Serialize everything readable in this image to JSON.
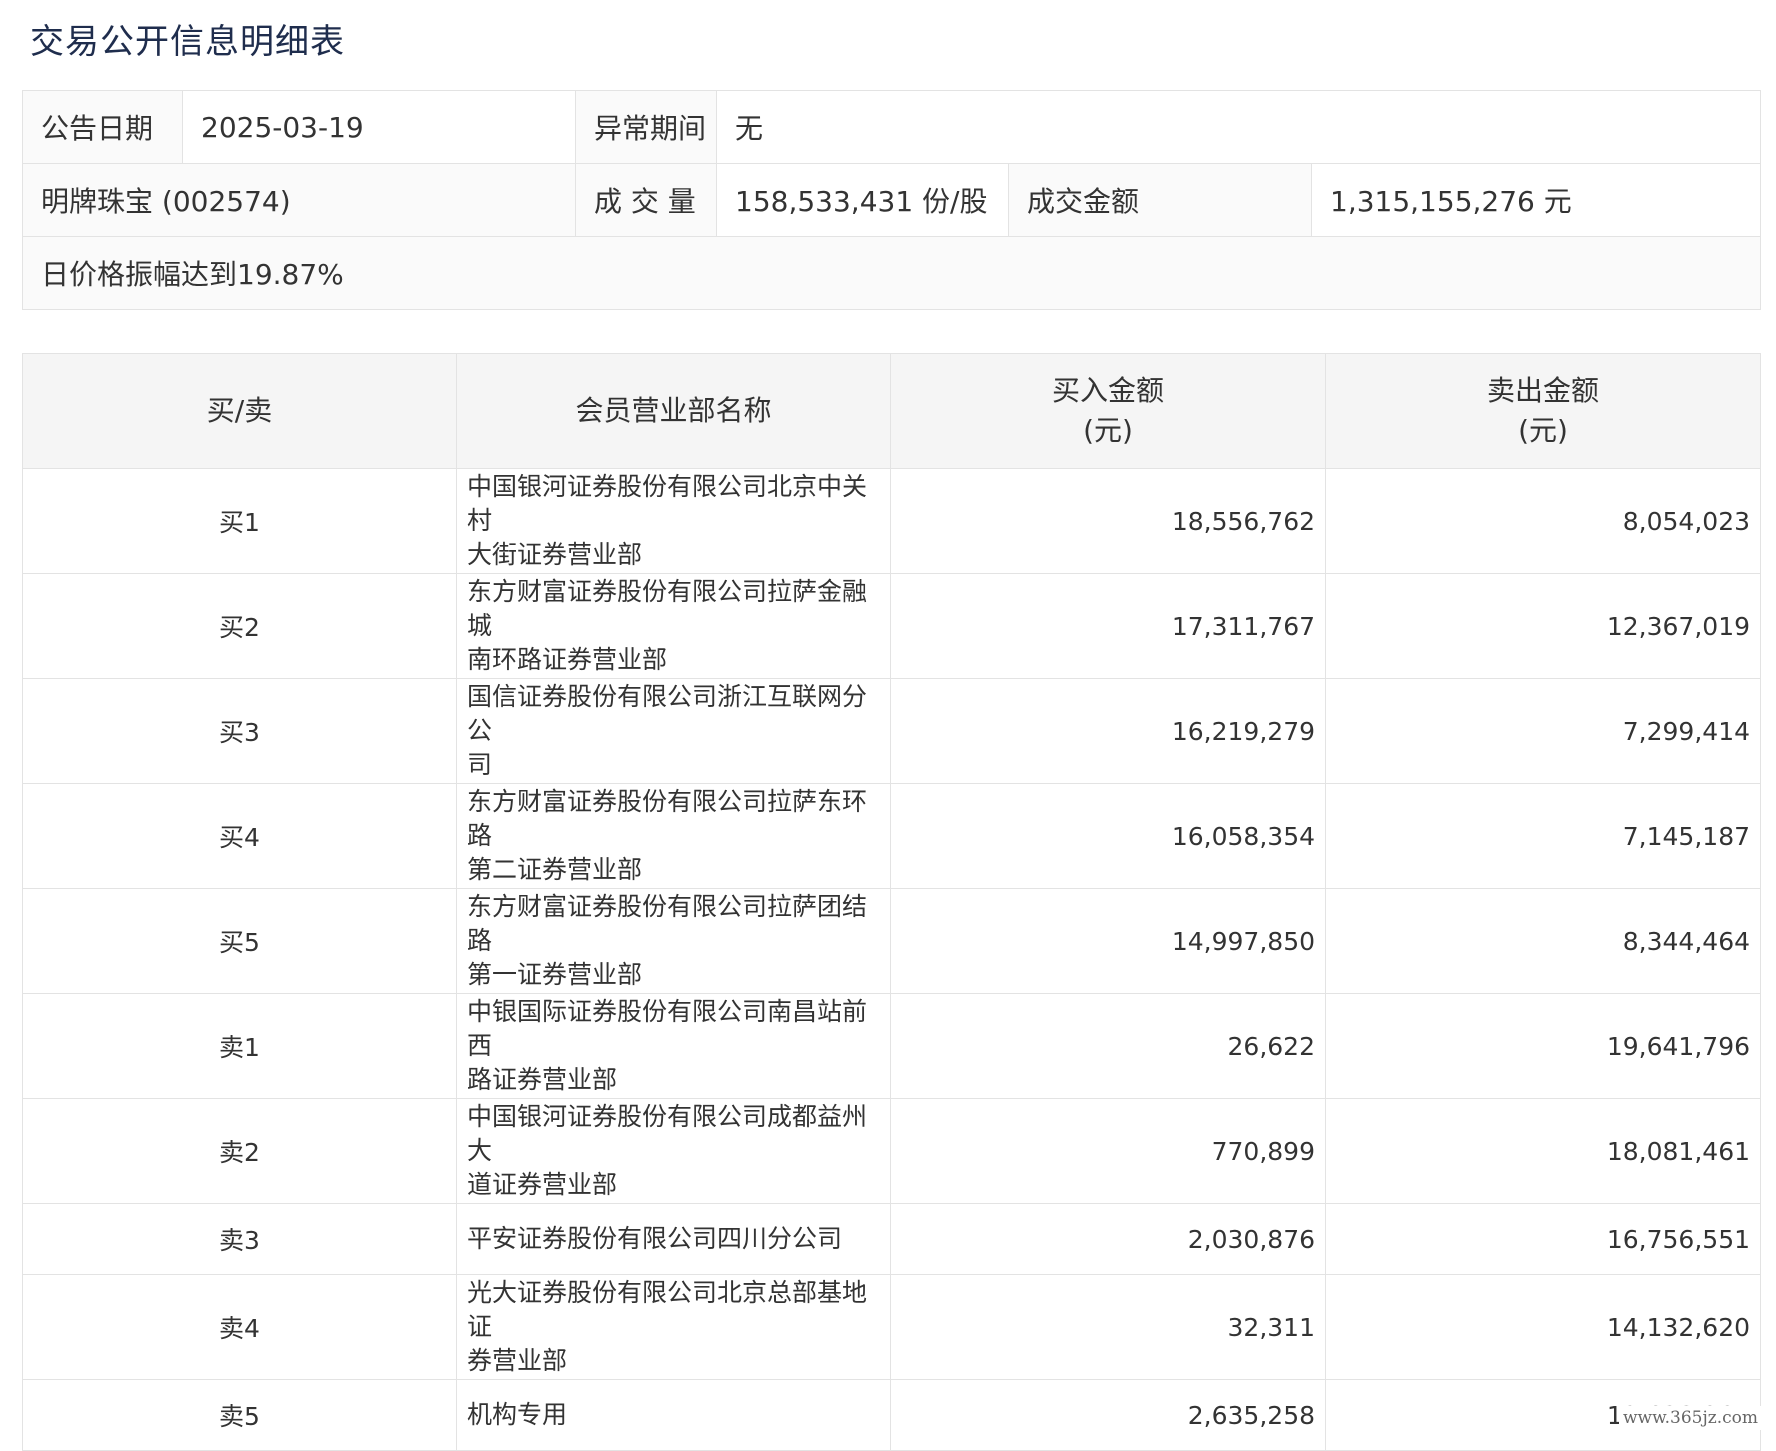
{
  "title": "交易公开信息明细表",
  "info": {
    "announce_date_label": "公告日期",
    "announce_date": "2025-03-19",
    "abnormal_period_label": "异常期间",
    "abnormal_period": "无",
    "stock": "明牌珠宝 (002574)",
    "volume_label": "成 交 量",
    "volume": "158,533,431 份/股",
    "amount_label": "成交金额",
    "amount": "1,315,155,276 元",
    "reason": "日价格振幅达到19.87%"
  },
  "detail": {
    "headers": {
      "side": "买/卖",
      "branch": "会员营业部名称",
      "buy_line1": "买入金额",
      "buy_line2": "(元)",
      "sell_line1": "卖出金额",
      "sell_line2": "(元)"
    },
    "rows": [
      {
        "side": "买1",
        "branch_line1": "中国银河证券股份有限公司北京中关村",
        "branch_line2": "大街证券营业部",
        "buy": "18,556,762",
        "sell": "8,054,023"
      },
      {
        "side": "买2",
        "branch_line1": "东方财富证券股份有限公司拉萨金融城",
        "branch_line2": "南环路证券营业部",
        "buy": "17,311,767",
        "sell": "12,367,019"
      },
      {
        "side": "买3",
        "branch_line1": "国信证券股份有限公司浙江互联网分公",
        "branch_line2": "司",
        "buy": "16,219,279",
        "sell": "7,299,414"
      },
      {
        "side": "买4",
        "branch_line1": "东方财富证券股份有限公司拉萨东环路",
        "branch_line2": "第二证券营业部",
        "buy": "16,058,354",
        "sell": "7,145,187"
      },
      {
        "side": "买5",
        "branch_line1": "东方财富证券股份有限公司拉萨团结路",
        "branch_line2": "第一证券营业部",
        "buy": "14,997,850",
        "sell": "8,344,464"
      },
      {
        "side": "卖1",
        "branch_line1": "中银国际证券股份有限公司南昌站前西",
        "branch_line2": "路证券营业部",
        "buy": "26,622",
        "sell": "19,641,796"
      },
      {
        "side": "卖2",
        "branch_line1": "中国银河证券股份有限公司成都益州大",
        "branch_line2": "道证券营业部",
        "buy": "770,899",
        "sell": "18,081,461"
      },
      {
        "side": "卖3",
        "branch_line1": "平安证券股份有限公司四川分公司",
        "branch_line2": "",
        "buy": "2,030,876",
        "sell": "16,756,551"
      },
      {
        "side": "卖4",
        "branch_line1": "光大证券股份有限公司北京总部基地证",
        "branch_line2": "券营业部",
        "buy": "32,311",
        "sell": "14,132,620"
      },
      {
        "side": "卖5",
        "branch_line1": "机构专用",
        "branch_line2": "",
        "buy": "2,635,258",
        "sell": "13,628,967"
      }
    ]
  },
  "watermark": "www.365jz.com"
}
